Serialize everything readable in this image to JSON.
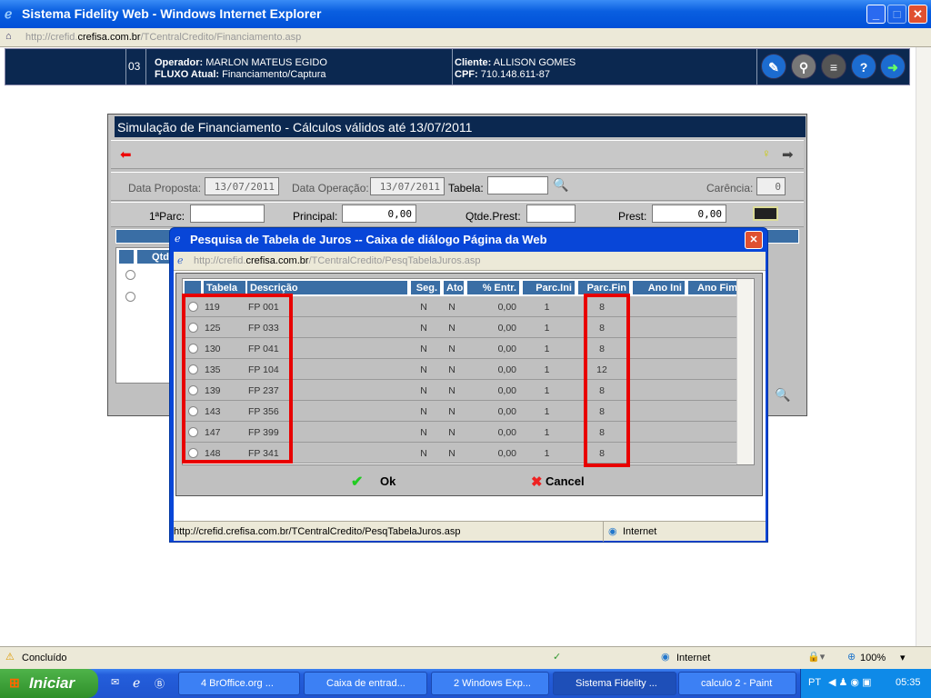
{
  "window": {
    "title": "Sistema Fidelity Web - Windows Internet Explorer",
    "address_prefix": "http://crefid.",
    "address_domain": "crefisa.com.br",
    "address_path": "/TCentralCredito/Financiamento.asp"
  },
  "header": {
    "code": "03",
    "operator_label": "Operador:",
    "operator": "MARLON MATEUS EGIDO",
    "flow_label": "FLUXO Atual:",
    "flow": "Financiamento/Captura",
    "client_label": "Cliente:",
    "client": "ALLISON GOMES",
    "cpf_label": "CPF:",
    "cpf": "710.148.611-87",
    "icons": [
      "edit-icon",
      "search-users-icon",
      "list-icon",
      "help-icon",
      "exit-icon"
    ]
  },
  "panel": {
    "title": "Simulação de Financiamento - Cálculos válidos até 13/07/2011",
    "data_proposta_label": "Data Proposta:",
    "data_proposta": "13/07/2011",
    "data_operacao_label": "Data Operação:",
    "data_operacao": "13/07/2011",
    "tabela_label": "Tabela:",
    "tabela": "",
    "carencia_label": "Carência:",
    "carencia": "0",
    "parc1_label": "1ªParc:",
    "parc1": "",
    "principal_label": "Principal:",
    "principal": "0,00",
    "qtde_label": "Qtde.Prest:",
    "qtde": "",
    "prest_label": "Prest:",
    "prest": "0,00",
    "bg_col": "Qtd"
  },
  "dialog": {
    "title": "Pesquisa de Tabela de Juros -- Caixa de diálogo Página da Web",
    "address_prefix": "http://crefid.",
    "address_domain": "crefisa.com.br",
    "address_path": "/TCentralCredito/PesqTabelaJuros.asp",
    "columns": [
      "Tabela",
      "Descrição",
      "Seg.",
      "Ato",
      "% Entr.",
      "Parc.Ini",
      "Parc.Fin",
      "Ano Ini",
      "Ano Fim"
    ],
    "rows": [
      [
        "119",
        "FP 001",
        "N",
        "N",
        "0,00",
        "1",
        "8",
        "",
        ""
      ],
      [
        "125",
        "FP 033",
        "N",
        "N",
        "0,00",
        "1",
        "8",
        "",
        ""
      ],
      [
        "130",
        "FP 041",
        "N",
        "N",
        "0,00",
        "1",
        "8",
        "",
        ""
      ],
      [
        "135",
        "FP 104",
        "N",
        "N",
        "0,00",
        "1",
        "12",
        "",
        ""
      ],
      [
        "139",
        "FP 237",
        "N",
        "N",
        "0,00",
        "1",
        "8",
        "",
        ""
      ],
      [
        "143",
        "FP 356",
        "N",
        "N",
        "0,00",
        "1",
        "8",
        "",
        ""
      ],
      [
        "147",
        "FP 399",
        "N",
        "N",
        "0,00",
        "1",
        "8",
        "",
        ""
      ],
      [
        "148",
        "FP 341",
        "N",
        "N",
        "0,00",
        "1",
        "8",
        "",
        ""
      ]
    ],
    "ok": "Ok",
    "cancel": "Cancel",
    "status_url": "http://crefid.crefisa.com.br/TCentralCredito/PesqTabelaJuros.asp",
    "zone": "Internet",
    "highlight_color": "#e80000"
  },
  "status": {
    "text": "Concluído",
    "zone": "Internet",
    "zoom": "100%"
  },
  "taskbar": {
    "start": "Iniciar",
    "tasks": [
      "4 BrOffice.org ...",
      "Caixa de entrad...",
      "2 Windows Exp...",
      "Sistema Fidelity ...",
      "calculo 2 - Paint"
    ],
    "lang": "PT",
    "clock": "05:35"
  }
}
